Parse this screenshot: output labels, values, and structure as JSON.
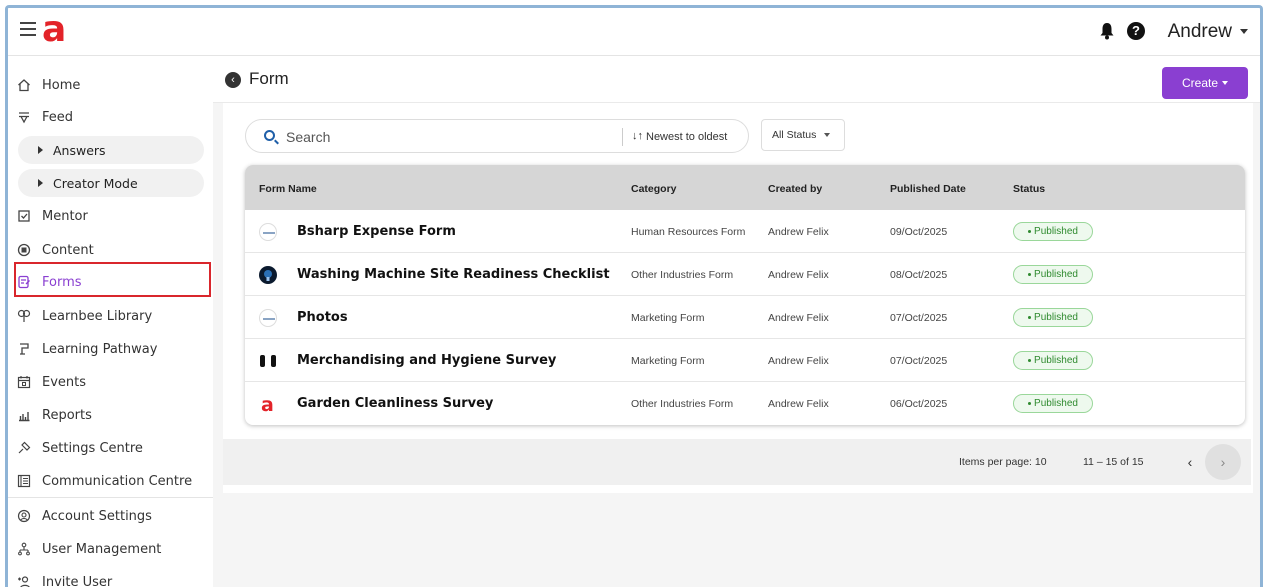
{
  "header": {
    "logo": "a",
    "user_name": "Andrew",
    "help_symbol": "?"
  },
  "sidebar": {
    "items": [
      {
        "label": "Home",
        "icon": "home-icon"
      },
      {
        "label": "Feed",
        "icon": "feed-icon"
      },
      {
        "label": "Answers",
        "icon": "caret-right-icon"
      },
      {
        "label": "Creator Mode",
        "icon": "caret-right-icon"
      },
      {
        "label": "Mentor",
        "icon": "checkbox-icon"
      },
      {
        "label": "Content",
        "icon": "content-icon"
      },
      {
        "label": "Forms",
        "icon": "forms-icon"
      },
      {
        "label": "Learnbee Library",
        "icon": "library-icon"
      },
      {
        "label": "Learning Pathway",
        "icon": "pathway-icon"
      },
      {
        "label": "Events",
        "icon": "calendar-icon"
      },
      {
        "label": "Reports",
        "icon": "reports-icon"
      },
      {
        "label": "Settings Centre",
        "icon": "settings-icon"
      },
      {
        "label": "Communication Centre",
        "icon": "communication-icon"
      },
      {
        "label": "Account Settings",
        "icon": "account-settings-icon"
      },
      {
        "label": "User Management",
        "icon": "user-management-icon"
      },
      {
        "label": "Invite User",
        "icon": "invite-user-icon"
      }
    ],
    "active": "Forms",
    "accent_color": "#8a3fd1",
    "highlight_color": "#d9262c"
  },
  "page": {
    "title": "Form",
    "create_label": "Create"
  },
  "toolbar": {
    "search_placeholder": "Search",
    "sort_label": "Newest to oldest",
    "status_filter": "All Status"
  },
  "table": {
    "columns": [
      "Form Name",
      "Category",
      "Created by",
      "Published Date",
      "Status"
    ],
    "rows": [
      {
        "name": "Bsharp Expense Form",
        "category": "Human Resources Form",
        "created_by": "Andrew Felix",
        "date": "09/Oct/2025",
        "status": "Published",
        "icon": "company-logo-icon"
      },
      {
        "name": "Washing Machine Site Readiness Checklist",
        "category": "Other Industries Form",
        "created_by": "Andrew Felix",
        "date": "08/Oct/2025",
        "status": "Published",
        "icon": "dark-globe-icon"
      },
      {
        "name": "Photos",
        "category": "Marketing Form",
        "created_by": "Andrew Felix",
        "date": "07/Oct/2025",
        "status": "Published",
        "icon": "company-logo-icon"
      },
      {
        "name": "Merchandising and Hygiene Survey",
        "category": "Marketing Form",
        "created_by": "Andrew Felix",
        "date": "07/Oct/2025",
        "status": "Published",
        "icon": "brackets-icon"
      },
      {
        "name": "Garden Cleanliness Survey",
        "category": "Other Industries Form",
        "created_by": "Andrew Felix",
        "date": "06/Oct/2025",
        "status": "Published",
        "icon": "a-logo-icon"
      }
    ]
  },
  "pagination": {
    "items_per_page": "Items per page: 10",
    "range": "11 – 15 of 15"
  }
}
